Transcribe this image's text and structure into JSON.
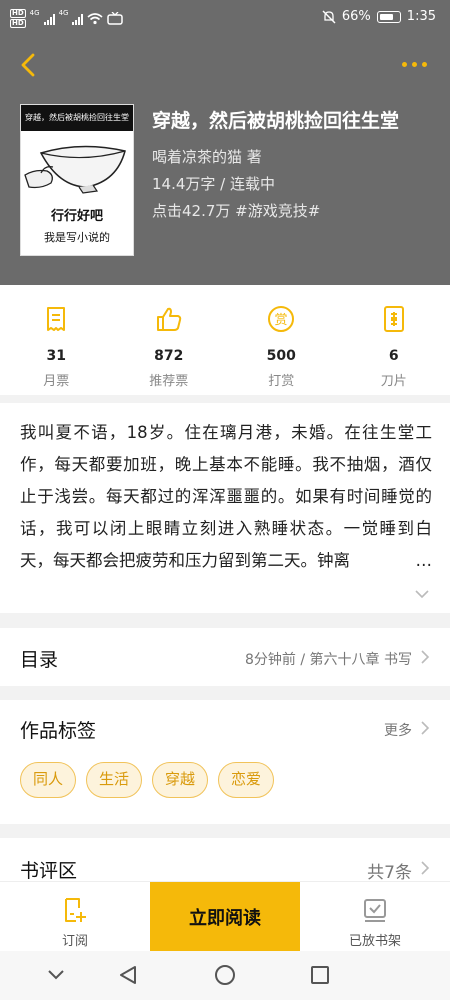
{
  "status_bar": {
    "hd_1": "HD",
    "hd_2": "HD",
    "net_1": "4G",
    "net_2": "4G",
    "battery": "66%",
    "time": "1:35"
  },
  "book": {
    "title": "穿越，然后被胡桃捡回往生堂",
    "author": "喝着凉茶的猫  著",
    "words_status": "14.4万字 / 连载中",
    "clicks_tag": "点击42.7万  #游戏竞技#",
    "cover": {
      "band": "穿越，然后被胡桃捡回往生堂",
      "line1": "行行好吧",
      "line2": "我是写小说的"
    }
  },
  "stats": [
    {
      "value": "31",
      "label": "月票",
      "icon": "ticket-icon"
    },
    {
      "value": "872",
      "label": "推荐票",
      "icon": "thumbs-up-icon"
    },
    {
      "value": "500",
      "label": "打赏",
      "icon": "reward-coin-icon"
    },
    {
      "value": "6",
      "label": "刀片",
      "icon": "blade-icon"
    }
  ],
  "stat_reward_char": "赏",
  "intro": "我叫夏不语，18岁。住在璃月港，未婚。在往生堂工作，每天都要加班，晚上基本不能睡。我不抽烟，酒仅止于浅尝。每天都过的浑浑噩噩的。如果有时间睡觉的话，我可以闭上眼睛立刻进入熟睡状态。一觉睡到白天，每天都会把疲劳和压力留到第二天。钟离",
  "toc": {
    "title": "目录",
    "latest": "8分钟前 / 第六十八章 书写"
  },
  "tags_section": {
    "title": "作品标签",
    "more": "更多",
    "tags": [
      "同人",
      "生活",
      "穿越",
      "恋爱"
    ]
  },
  "reviews": {
    "title": "书评区",
    "count": "共7条"
  },
  "bottom_bar": {
    "subscribe": "订阅",
    "read_now": "立即阅读",
    "on_shelf": "已放书架"
  },
  "colors": {
    "accent": "#f5b90a",
    "header_bg": "#6b6b6b"
  }
}
